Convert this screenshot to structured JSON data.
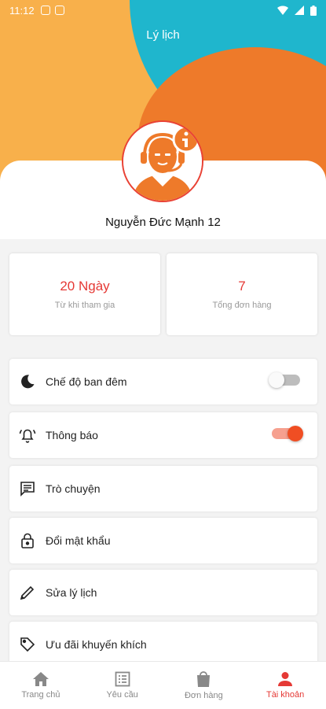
{
  "status_bar": {
    "time": "11:12"
  },
  "header": {
    "title": "Lý lịch"
  },
  "profile": {
    "name": "Nguyễn Đức Mạnh 12"
  },
  "stats": [
    {
      "value": "20 Ngày",
      "label": "Từ khi tham gia"
    },
    {
      "value": "7",
      "label": "Tổng đơn hàng"
    }
  ],
  "menu": [
    {
      "label": "Chế độ ban đêm",
      "icon": "moon-icon",
      "toggle": false
    },
    {
      "label": "Thông báo",
      "icon": "bell-icon",
      "toggle": true
    },
    {
      "label": "Trò chuyện",
      "icon": "chat-icon"
    },
    {
      "label": "Đổi mật khẩu",
      "icon": "lock-icon"
    },
    {
      "label": "Sửa lý lịch",
      "icon": "pencil-icon"
    },
    {
      "label": "Ưu đãi khuyến khích",
      "icon": "tag-icon"
    }
  ],
  "nav": [
    {
      "label": "Trang chủ",
      "icon": "home-icon"
    },
    {
      "label": "Yêu cầu",
      "icon": "list-icon"
    },
    {
      "label": "Đơn hàng",
      "icon": "bag-icon"
    },
    {
      "label": "Tài khoản",
      "icon": "person-icon",
      "active": true
    }
  ],
  "colors": {
    "accent": "#e53935",
    "teal": "#1fb6cd",
    "orange": "#ee7a2a",
    "yellow": "#f8b04b"
  }
}
